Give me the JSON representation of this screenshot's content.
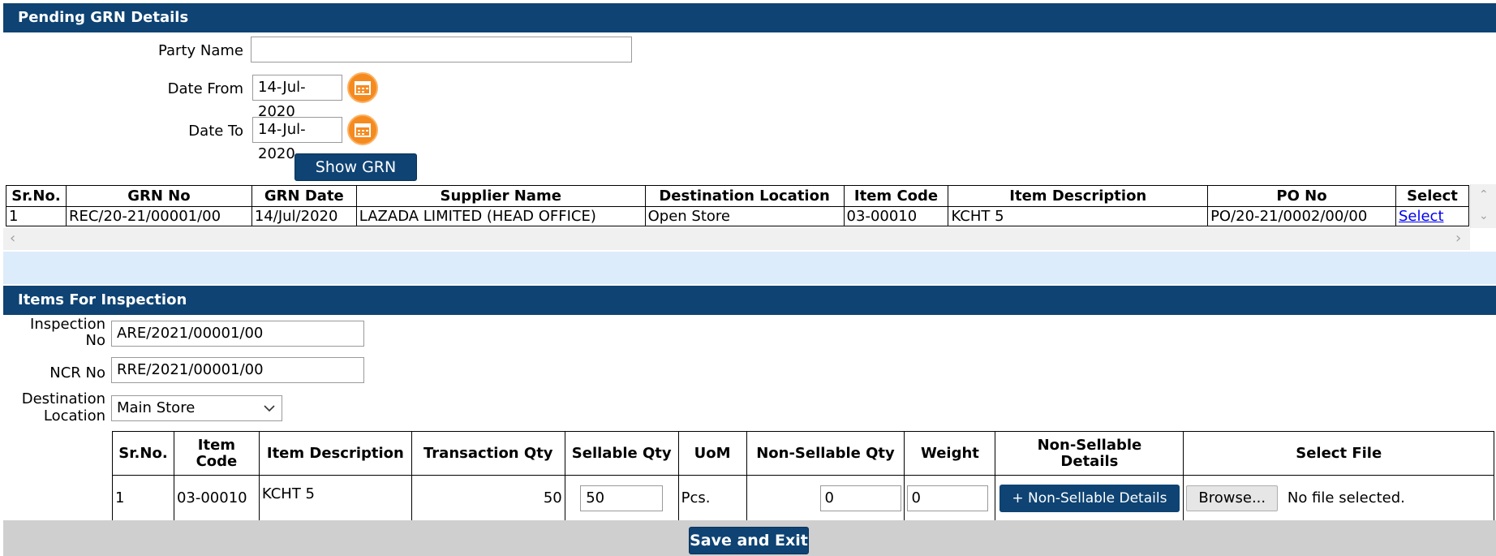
{
  "pending_grn": {
    "header": "Pending GRN Details",
    "party_name_label": "Party Name",
    "party_name_value": "",
    "date_from_label": "Date From",
    "date_from_value": "14-Jul-2020",
    "date_to_label": "Date To",
    "date_to_value": "14-Jul-2020",
    "show_button": "Show GRN",
    "columns": [
      "Sr.No.",
      "GRN No",
      "GRN Date",
      "Supplier Name",
      "Destination Location",
      "Item Code",
      "Item Description",
      "PO No",
      "Select"
    ],
    "rows": [
      {
        "sr": "1",
        "grn_no": "REC/20-21/00001/00",
        "grn_date": "14/Jul/2020",
        "supplier": "LAZADA LIMITED (HEAD OFFICE)",
        "destination": "Open Store",
        "item_code": "03-00010",
        "item_desc": "KCHT 5",
        "po_no": "PO/20-21/0002/00/00",
        "select": "Select"
      }
    ]
  },
  "inspection": {
    "header": "Items For Inspection",
    "inspection_no_label_1": "Inspection",
    "inspection_no_label_2": "No",
    "inspection_no_value": "ARE/2021/00001/00",
    "ncr_no_label": "NCR No",
    "ncr_no_value": "RRE/2021/00001/00",
    "destination_label_1": "Destination",
    "destination_label_2": "Location",
    "destination_value": "Main Store",
    "columns": {
      "sr": "Sr.No.",
      "item_code_1": "Item",
      "item_code_2": "Code",
      "item_desc": "Item Description",
      "trans_qty": "Transaction Qty",
      "sellable_qty": "Sellable Qty",
      "uom": "UoM",
      "non_sellable_qty": "Non-Sellable Qty",
      "weight": "Weight",
      "ns_details_1": "Non-Sellable",
      "ns_details_2": "Details",
      "select_file": "Select File"
    },
    "rows": [
      {
        "sr": "1",
        "item_code": "03-00010",
        "item_desc": "KCHT 5",
        "trans_qty": "50",
        "sellable_qty": "50",
        "uom": "Pcs.",
        "non_sellable_qty": "0",
        "weight": "0",
        "ns_button": "+ Non-Sellable Details",
        "browse_button": "Browse...",
        "file_status": "No file selected."
      }
    ],
    "save_button": "Save and Exit"
  },
  "colors": {
    "header_bg": "#0e4373",
    "calendar_icon": "#f58a1f",
    "info_band": "#dcecfb",
    "footer_bar": "#cfcfcf"
  }
}
